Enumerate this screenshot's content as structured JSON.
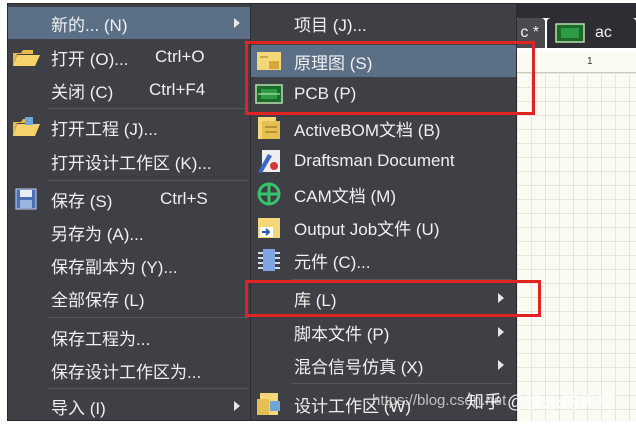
{
  "left_menu": {
    "items": [
      {
        "label": "新的... (N)",
        "shortcut": "",
        "icon": "",
        "submenu": true,
        "highlighted": true
      },
      {
        "label": "打开 (O)...",
        "shortcut": "Ctrl+O",
        "icon": "folder-open-icon"
      },
      {
        "label": "关闭 (C)",
        "shortcut": "Ctrl+F4",
        "icon": ""
      },
      {
        "label": "打开工程 (J)...",
        "shortcut": "",
        "icon": "open-project-icon"
      },
      {
        "label": "打开设计工作区 (K)...",
        "shortcut": "",
        "icon": ""
      },
      {
        "label": "保存 (S)",
        "shortcut": "Ctrl+S",
        "icon": "save-icon"
      },
      {
        "label": "另存为 (A)...",
        "shortcut": "",
        "icon": ""
      },
      {
        "label": "保存副本为 (Y)...",
        "shortcut": "",
        "icon": ""
      },
      {
        "label": "全部保存 (L)",
        "shortcut": "",
        "icon": ""
      },
      {
        "label": "保存工程为...",
        "shortcut": "",
        "icon": ""
      },
      {
        "label": "保存设计工作区为...",
        "shortcut": "",
        "icon": ""
      },
      {
        "label": "导入 (I)",
        "shortcut": "",
        "icon": "",
        "submenu": true
      }
    ]
  },
  "right_menu": {
    "items": [
      {
        "label": "项目 (J)...",
        "icon": ""
      },
      {
        "label": "原理图 (S)",
        "icon": "schematic-icon",
        "highlighted": true
      },
      {
        "label": "PCB (P)",
        "icon": "pcb-icon"
      },
      {
        "label": "ActiveBOM文档 (B)",
        "icon": "activebom-icon"
      },
      {
        "label": "Draftsman Document",
        "icon": "draftsman-icon"
      },
      {
        "label": "CAM文档 (M)",
        "icon": "cam-icon"
      },
      {
        "label": "Output Job文件 (U)",
        "icon": "output-job-icon"
      },
      {
        "label": "元件 (C)...",
        "icon": "component-icon"
      },
      {
        "label": "库 (L)",
        "icon": "",
        "submenu": true
      },
      {
        "label": "脚本文件 (P)",
        "icon": "",
        "submenu": true
      },
      {
        "label": "混合信号仿真 (X)",
        "icon": "",
        "submenu": true
      },
      {
        "label": "设计工作区 (W)",
        "icon": "workspace-icon"
      }
    ]
  },
  "background": {
    "tab1_label": "c *",
    "tab2_label": "ac",
    "ruler_mark": "1"
  },
  "watermark": {
    "url": "https://blog.csdn.net",
    "text": "知乎 @快乐的天空"
  },
  "colors": {
    "menu_bg": "#3f3f46",
    "highlight": "#5b6f86",
    "annotation_red": "#e02424"
  }
}
